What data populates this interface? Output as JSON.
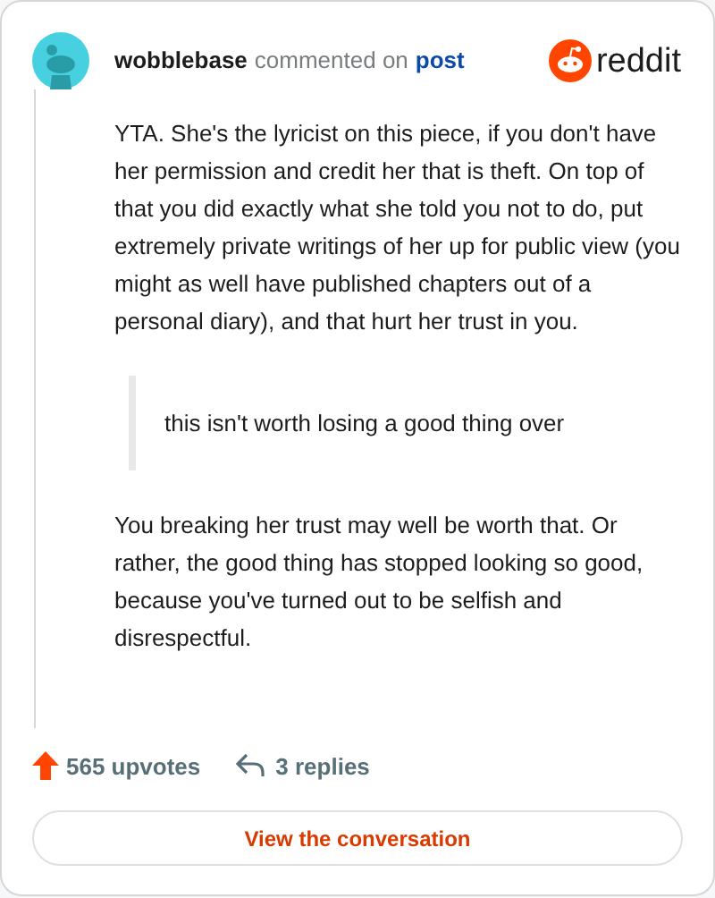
{
  "header": {
    "username": "wobblebase",
    "action": "commented on",
    "link": "post",
    "brand": "reddit"
  },
  "body": [
    {
      "kind": "paragraph",
      "text": "YTA. She's the lyricist on this piece, if you don't have her permission and credit her that is theft. On top of that you did exactly what she told you not to do, put extremely private writings of her up for public view (you might as well have published chapters out of a personal diary), and that hurt her trust in you."
    },
    {
      "kind": "quote",
      "text": "this isn't worth losing a good thing over"
    },
    {
      "kind": "paragraph",
      "text": "You breaking her trust may well be worth that. Or rather, the good thing has stopped looking so good, because you've turned out to be selfish and disrespectful."
    }
  ],
  "stats": {
    "upvotes": "565 upvotes",
    "replies": "3 replies"
  },
  "button": "View the conversation"
}
